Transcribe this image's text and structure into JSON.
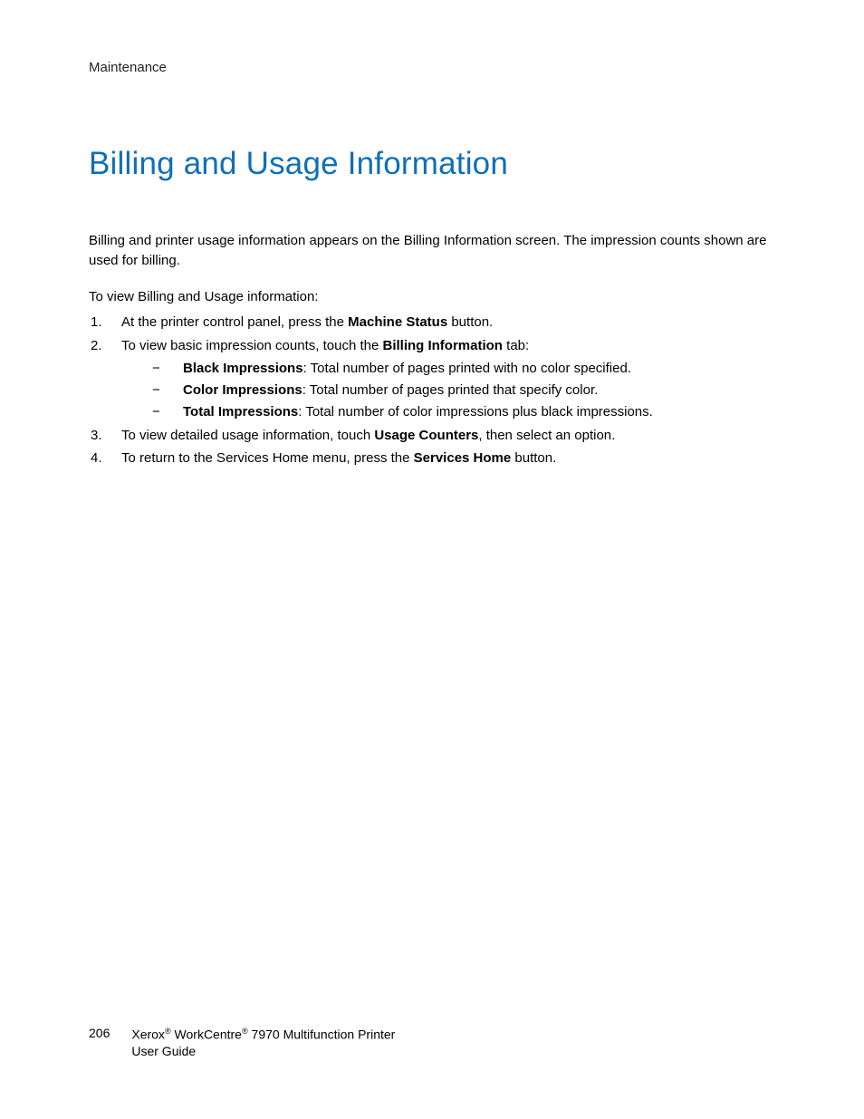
{
  "header": {
    "section": "Maintenance"
  },
  "title": "Billing and Usage Information",
  "intro": "Billing and printer usage information appears on the Billing Information screen. The impression counts shown are used for billing.",
  "lead": "To view Billing and Usage information:",
  "steps": {
    "s1_a": "At the printer control panel, press the ",
    "s1_b": "Machine Status",
    "s1_c": " button.",
    "s2_a": "To view basic impression counts, touch the ",
    "s2_b": "Billing Information",
    "s2_c": " tab:",
    "sub1_b": "Black Impressions",
    "sub1_t": ": Total number of pages printed with no color specified.",
    "sub2_b": "Color Impressions",
    "sub2_t": ": Total number of pages printed that specify color.",
    "sub3_b": "Total Impressions",
    "sub3_t": ": Total number of color impressions plus black impressions.",
    "s3_a": "To view detailed usage information, touch ",
    "s3_b": "Usage Counters",
    "s3_c": ", then select an option.",
    "s4_a": "To return to the Services Home menu, press the ",
    "s4_b": "Services Home",
    "s4_c": " button."
  },
  "footer": {
    "page": "206",
    "brand1": "Xerox",
    "reg": "®",
    "brand2": " WorkCentre",
    "tail": " 7970 Multifunction Printer",
    "line2": "User Guide"
  }
}
